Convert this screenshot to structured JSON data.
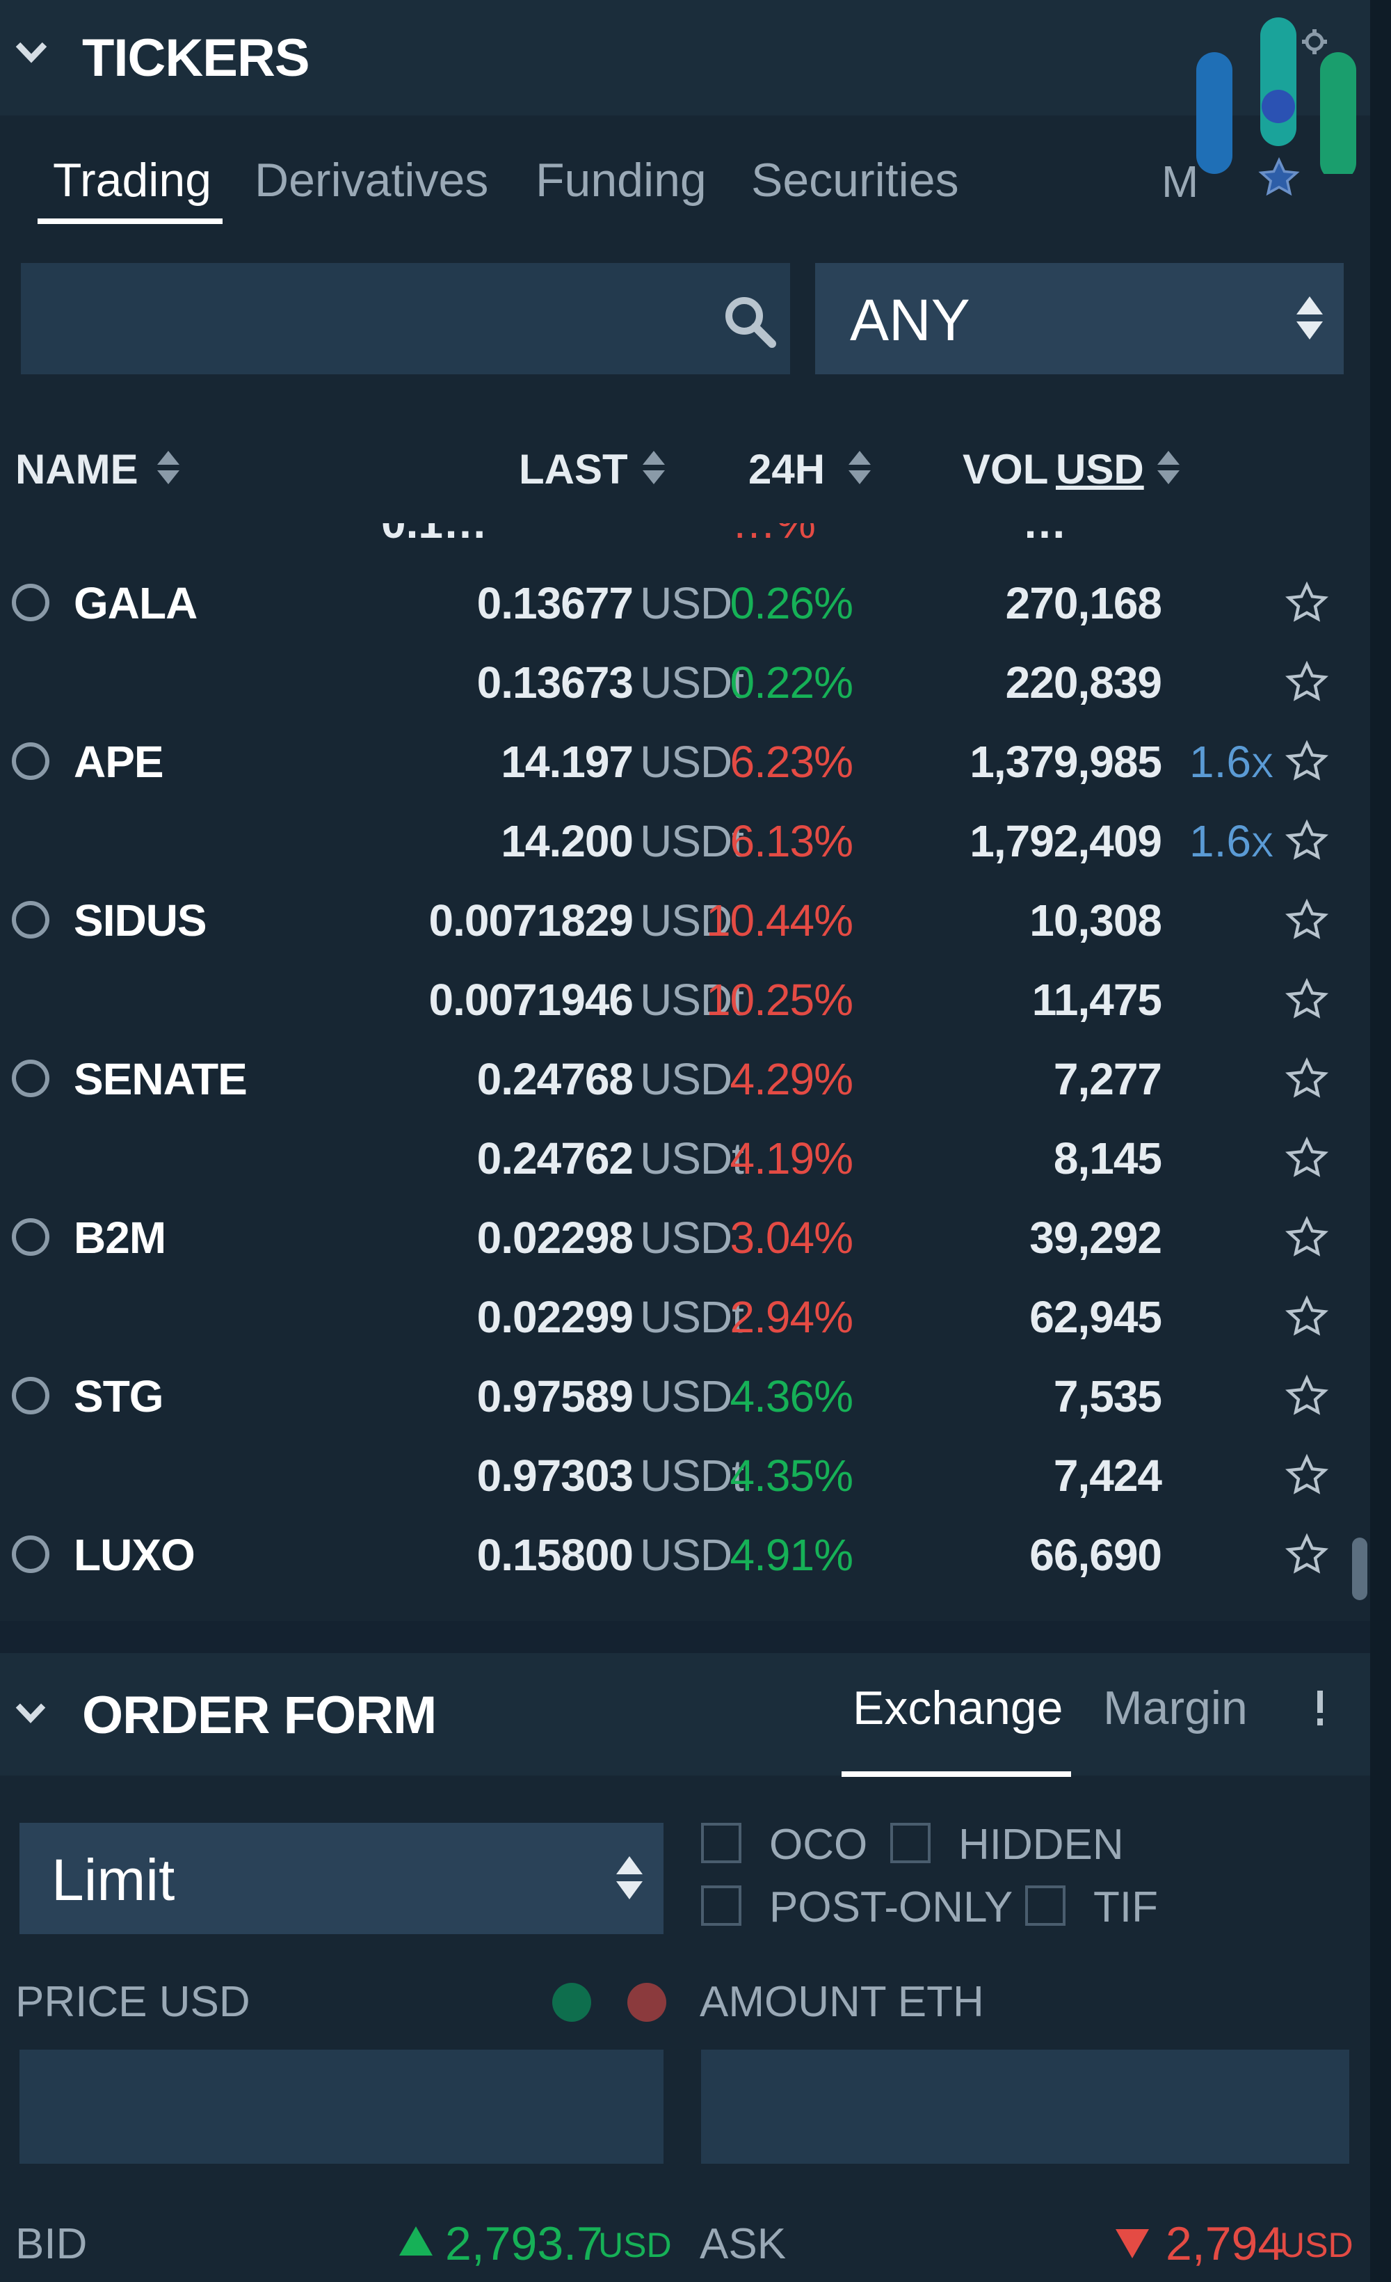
{
  "tickers": {
    "title": "TICKERS",
    "tabs": [
      "Trading",
      "Derivatives",
      "Funding",
      "Securities"
    ],
    "tab_m": "M",
    "currency_filter": "ANY",
    "columns": {
      "name": "NAME",
      "last": "LAST",
      "change": "24H",
      "vol": "VOL",
      "vol_unit": "USD"
    },
    "partial_row": {
      "last": "0.1…",
      "change": "…%",
      "vol": "…"
    },
    "rows": [
      {
        "symbol": "GALA",
        "last": "0.13677",
        "cur": "USD",
        "change": "0.26%",
        "dir": "up",
        "vol": "270,168",
        "lev": ""
      },
      {
        "symbol": "",
        "last": "0.13673",
        "cur": "USDt",
        "change": "0.22%",
        "dir": "up",
        "vol": "220,839",
        "lev": ""
      },
      {
        "symbol": "APE",
        "last": "14.197",
        "cur": "USD",
        "change": "6.23%",
        "dir": "down",
        "vol": "1,379,985",
        "lev": "1.6",
        "lev_x": "X"
      },
      {
        "symbol": "",
        "last": "14.200",
        "cur": "USDt",
        "change": "6.13%",
        "dir": "down",
        "vol": "1,792,409",
        "lev": "1.6",
        "lev_x": "X"
      },
      {
        "symbol": "SIDUS",
        "last": "0.0071829",
        "cur": "USD",
        "change": "10.44%",
        "dir": "down",
        "vol": "10,308",
        "lev": ""
      },
      {
        "symbol": "",
        "last": "0.0071946",
        "cur": "USDt",
        "change": "10.25%",
        "dir": "down",
        "vol": "11,475",
        "lev": ""
      },
      {
        "symbol": "SENATE",
        "last": "0.24768",
        "cur": "USD",
        "change": "4.29%",
        "dir": "down",
        "vol": "7,277",
        "lev": ""
      },
      {
        "symbol": "",
        "last": "0.24762",
        "cur": "USDt",
        "change": "4.19%",
        "dir": "down",
        "vol": "8,145",
        "lev": ""
      },
      {
        "symbol": "B2M",
        "last": "0.02298",
        "cur": "USD",
        "change": "3.04%",
        "dir": "down",
        "vol": "39,292",
        "lev": ""
      },
      {
        "symbol": "",
        "last": "0.02299",
        "cur": "USDt",
        "change": "2.94%",
        "dir": "down",
        "vol": "62,945",
        "lev": ""
      },
      {
        "symbol": "STG",
        "last": "0.97589",
        "cur": "USD",
        "change": "4.36%",
        "dir": "up",
        "vol": "7,535",
        "lev": ""
      },
      {
        "symbol": "",
        "last": "0.97303",
        "cur": "USDt",
        "change": "4.35%",
        "dir": "up",
        "vol": "7,424",
        "lev": ""
      },
      {
        "symbol": "LUXO",
        "last": "0.15800",
        "cur": "USD",
        "change": "4.91%",
        "dir": "up",
        "vol": "66,690",
        "lev": ""
      }
    ]
  },
  "order_form": {
    "title": "ORDER FORM",
    "tabs": [
      "Exchange",
      "Margin"
    ],
    "order_type": "Limit",
    "options": [
      "OCO",
      "HIDDEN",
      "POST-ONLY",
      "TIF"
    ],
    "price_label": "PRICE USD",
    "amount_label": "AMOUNT ETH",
    "bid_label": "BID",
    "bid_value": "2,793.7",
    "bid_unit": "USD",
    "ask_label": "ASK",
    "ask_value": "2,794",
    "ask_unit": "USD"
  },
  "colors": {
    "background": "#172633",
    "panel": "#1b2d3b",
    "input": "#233a4e",
    "up": "#16b157",
    "down": "#e44b44",
    "leverage": "#5b9bd5"
  },
  "icons": [
    "chevron-down-icon",
    "settings-icon",
    "search-icon",
    "sort-arrows-icon",
    "star-icon",
    "radio-icon",
    "brand-logo"
  ]
}
